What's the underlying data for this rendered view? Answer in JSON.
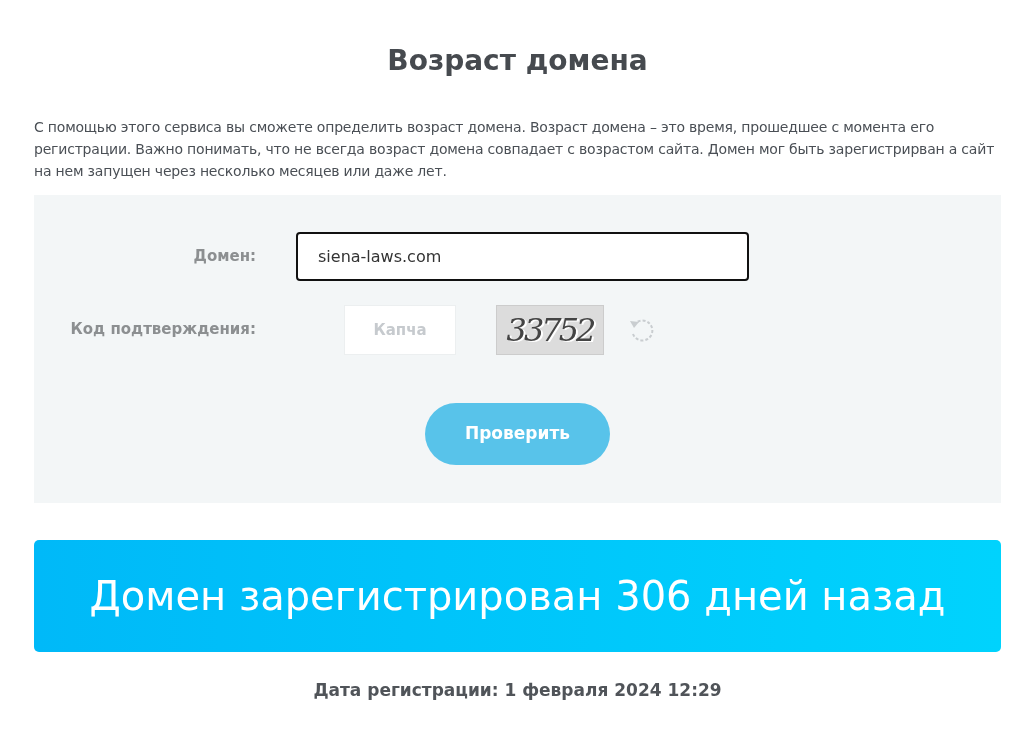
{
  "title": "Возраст домена",
  "description": "С помощью этого сервиса вы сможете определить возраст домена. Возраст домена – это время, прошедшее с момента его регистрации. Важно понимать, что не всегда возраст домена совпадает с возрастом сайта. Домен мог быть зарегистрирван а сайт на нем запущен через несколько месяцев или даже лет.",
  "form": {
    "domain": {
      "label": "Домен:",
      "value": "siena-laws.com",
      "focused": true
    },
    "captcha": {
      "label": "Код подтверждения:",
      "placeholder": "Капча",
      "code": "33752"
    },
    "submit": "Проверить"
  },
  "result": "Домен зарегистрирован 306 дней назад",
  "registration_date": "Дата регистрации: 1 февраля 2024 12:29"
}
